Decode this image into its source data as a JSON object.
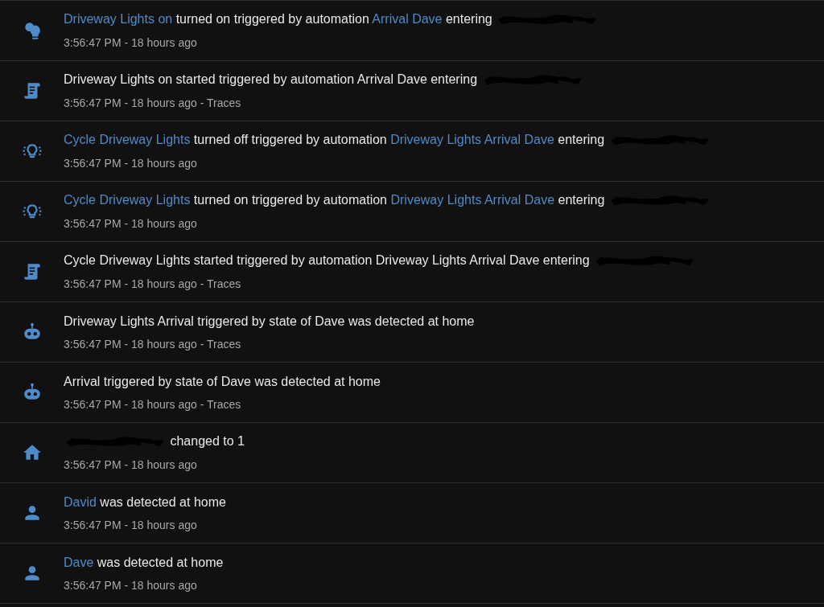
{
  "logbook": [
    {
      "kind": "bulb-group",
      "message": [
        {
          "kind": "link",
          "text": "Driveway Lights on"
        },
        {
          "kind": "text",
          "text": "turned on triggered by automation"
        },
        {
          "kind": "link",
          "text": "Arrival Dave"
        },
        {
          "kind": "text",
          "text": "entering"
        },
        {
          "kind": "redacted"
        }
      ],
      "time": "3:56:47 PM - 18 hours ago"
    },
    {
      "kind": "script",
      "message": [
        {
          "kind": "text",
          "text": "Driveway Lights on started triggered by automation Arrival Dave entering"
        },
        {
          "kind": "redacted"
        }
      ],
      "time": "3:56:47 PM - 18 hours ago -",
      "traces": "Traces"
    },
    {
      "kind": "bulb-cycle",
      "message": [
        {
          "kind": "link",
          "text": "Cycle Driveway Lights"
        },
        {
          "kind": "text",
          "text": "turned off triggered by automation"
        },
        {
          "kind": "link",
          "text": "Driveway Lights Arrival Dave"
        },
        {
          "kind": "text",
          "text": "entering"
        },
        {
          "kind": "redacted"
        }
      ],
      "time": "3:56:47 PM - 18 hours ago"
    },
    {
      "kind": "bulb-cycle",
      "message": [
        {
          "kind": "link",
          "text": "Cycle Driveway Lights"
        },
        {
          "kind": "text",
          "text": "turned on triggered by automation"
        },
        {
          "kind": "link",
          "text": "Driveway Lights Arrival Dave"
        },
        {
          "kind": "text",
          "text": "entering"
        },
        {
          "kind": "redacted"
        }
      ],
      "time": "3:56:47 PM - 18 hours ago"
    },
    {
      "kind": "script",
      "message": [
        {
          "kind": "text",
          "text": "Cycle Driveway Lights started triggered by automation Driveway Lights Arrival Dave entering"
        },
        {
          "kind": "redacted"
        }
      ],
      "time": "3:56:47 PM - 18 hours ago -",
      "traces": "Traces"
    },
    {
      "kind": "robot",
      "message": [
        {
          "kind": "text",
          "text": "Driveway Lights Arrival triggered by state of Dave was detected at home"
        }
      ],
      "time": "3:56:47 PM - 18 hours ago -",
      "traces": "Traces"
    },
    {
      "kind": "robot",
      "message": [
        {
          "kind": "text",
          "text": "Arrival triggered by state of Dave was detected at home"
        }
      ],
      "time": "3:56:47 PM - 18 hours ago -",
      "traces": "Traces"
    },
    {
      "kind": "home",
      "message": [
        {
          "kind": "redacted"
        },
        {
          "kind": "text",
          "text": "changed to 1"
        }
      ],
      "time": "3:56:47 PM - 18 hours ago"
    },
    {
      "kind": "person",
      "message": [
        {
          "kind": "link",
          "text": "David"
        },
        {
          "kind": "text",
          "text": "was detected at home"
        }
      ],
      "time": "3:56:47 PM - 18 hours ago"
    },
    {
      "kind": "person",
      "message": [
        {
          "kind": "link",
          "text": "Dave"
        },
        {
          "kind": "text",
          "text": "was detected at home"
        }
      ],
      "time": "3:56:47 PM - 18 hours ago"
    }
  ]
}
